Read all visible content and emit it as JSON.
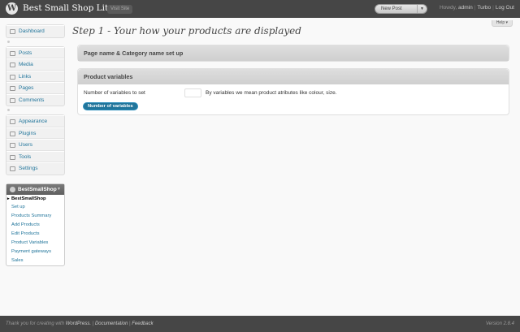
{
  "header": {
    "logo_glyph": "W",
    "site_title": "Best Small Shop Lite",
    "visit_site": "Visit Site",
    "favorite_action": "New Post",
    "howdy": "Howdy,",
    "username": "admin",
    "turbo": "Turbo",
    "logout": "Log Out"
  },
  "help_label": "Help ▾",
  "menu": {
    "group1": [
      {
        "label": "Dashboard",
        "icon": "dashboard-icon"
      }
    ],
    "group2": [
      {
        "label": "Posts",
        "icon": "pin-icon"
      },
      {
        "label": "Media",
        "icon": "media-icon"
      },
      {
        "label": "Links",
        "icon": "link-icon"
      },
      {
        "label": "Pages",
        "icon": "page-icon"
      },
      {
        "label": "Comments",
        "icon": "comment-icon"
      }
    ],
    "group3": [
      {
        "label": "Appearance",
        "icon": "appearance-icon"
      },
      {
        "label": "Plugins",
        "icon": "plugin-icon"
      },
      {
        "label": "Users",
        "icon": "users-icon"
      },
      {
        "label": "Tools",
        "icon": "tools-icon"
      },
      {
        "label": "Settings",
        "icon": "settings-icon"
      }
    ],
    "shop": {
      "title": "BestSmallShop",
      "items": [
        "BestSmallShop",
        "Set up",
        "Products Summary",
        "Add Products",
        "Edit Products",
        "Product Variables",
        "Payment gateways",
        "Sales"
      ]
    }
  },
  "main": {
    "heading": "Step 1 - Your how your products are displayed",
    "box1_title": "Page name & Category name set up",
    "box2_title": "Product variables",
    "vars_label": "Number of variables to set",
    "vars_value": "",
    "vars_help": "By variables we mean product atributes like colour, size.",
    "vars_button": "Number of variables"
  },
  "footer": {
    "thanks": "Thank you for creating with",
    "wordpress": "WordPress.",
    "documentation": "Documentation",
    "feedback": "Feedback",
    "version": "Version 2.8.4"
  },
  "colors": {
    "header_bg": "#464646",
    "link": "#21759b",
    "button": "#21759b"
  }
}
